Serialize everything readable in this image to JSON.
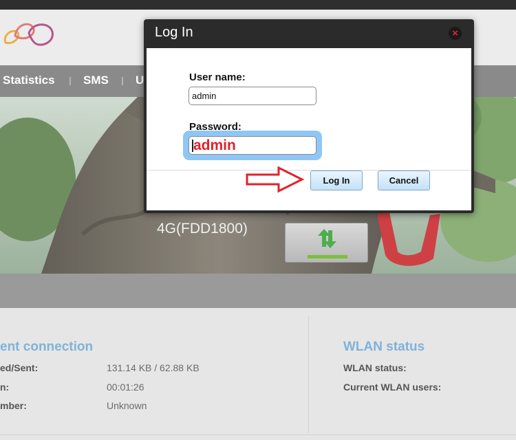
{
  "nav": {
    "items": [
      "Statistics",
      "SMS",
      "U"
    ]
  },
  "banner": {
    "network_type": "4G(FDD1800)"
  },
  "connection": {
    "title": "ent connection",
    "rows": [
      {
        "label": "ed/Sent:",
        "value": "131.14 KB /  62.88 KB"
      },
      {
        "label": "n:",
        "value": "00:01:26"
      },
      {
        "label": "mber:",
        "value": "Unknown"
      }
    ]
  },
  "wlan": {
    "title": "WLAN status",
    "rows": [
      {
        "label": "WLAN status:"
      },
      {
        "label": "Current WLAN users:"
      }
    ]
  },
  "login_dialog": {
    "title": "Log In",
    "username_label": "User name:",
    "username_value": "admin",
    "password_label": "Password:",
    "password_value": "admin",
    "login_button": "Log In",
    "cancel_button": "Cancel"
  },
  "colors": {
    "accent_blue": "#7fb2d8",
    "annotation_red": "#e3202a",
    "focus_ring": "#8fc6f6"
  }
}
